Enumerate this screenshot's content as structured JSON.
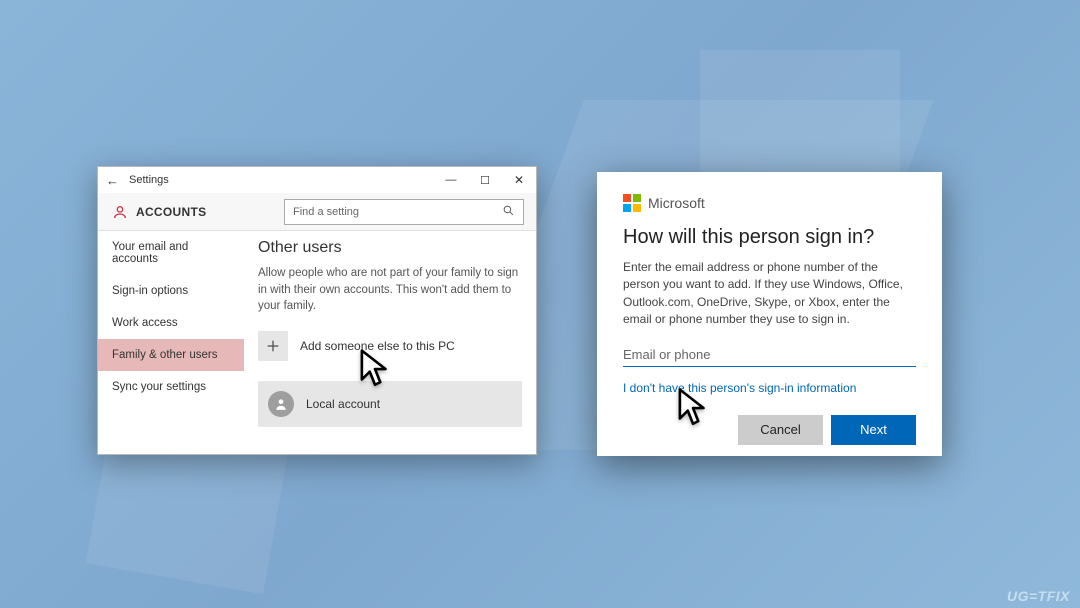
{
  "settings": {
    "titlebar": {
      "back": "←",
      "title": "Settings",
      "min": "—",
      "max": "☐",
      "close": "✕"
    },
    "accounts_label": "ACCOUNTS",
    "search_placeholder": "Find a setting",
    "sidebar": {
      "items": [
        {
          "label": "Your email and accounts"
        },
        {
          "label": "Sign-in options"
        },
        {
          "label": "Work access"
        },
        {
          "label": "Family & other users"
        },
        {
          "label": "Sync your settings"
        }
      ]
    },
    "content": {
      "heading": "Other users",
      "paragraph": "Allow people who are not part of your family to sign in with their own accounts. This won't add them to your family.",
      "add_label": "Add someone else to this PC",
      "local_label": "Local account"
    }
  },
  "dialog": {
    "brand": "Microsoft",
    "heading": "How will this person sign in?",
    "paragraph": "Enter the email address or phone number of the person you want to add. If they use Windows, Office, Outlook.com, OneDrive, Skype, or Xbox, enter the email or phone number they use to sign in.",
    "input_placeholder": "Email or phone",
    "link": "I don't have this person's sign-in information",
    "cancel": "Cancel",
    "next": "Next"
  },
  "watermark": "UG=TFIX"
}
